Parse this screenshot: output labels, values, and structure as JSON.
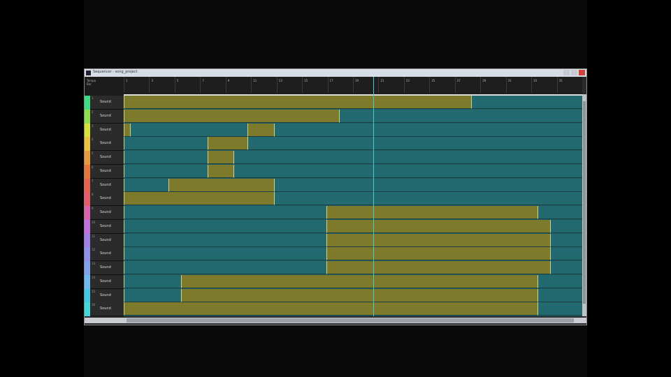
{
  "window": {
    "title": "Sequencer - song_project",
    "controls": [
      "minimize",
      "maximize",
      "close"
    ]
  },
  "corner": {
    "line1": "Tempo",
    "line2": "Bar"
  },
  "ruler": {
    "bars": [
      1,
      3,
      5,
      7,
      9,
      11,
      13,
      15,
      17,
      19,
      21,
      23,
      25,
      27,
      29,
      31,
      33,
      35
    ],
    "total_bars": 36
  },
  "playhead_bar": 19.6,
  "colors": {
    "olive": "#7d7a2c",
    "teal": "#236a70",
    "playhead": "#3fd3c6"
  },
  "tracks": [
    {
      "num": "1",
      "name": "Sound",
      "color": "#3ddc84",
      "clips": [
        {
          "s": 0,
          "e": 27.3,
          "t": "olive"
        },
        {
          "s": 27.3,
          "e": 36,
          "t": "teal"
        }
      ]
    },
    {
      "num": "2",
      "name": "Sound",
      "color": "#8ee04a",
      "clips": [
        {
          "s": 0,
          "e": 16.9,
          "t": "olive"
        },
        {
          "s": 16.9,
          "e": 36,
          "t": "teal"
        }
      ]
    },
    {
      "num": "3",
      "name": "Sound",
      "color": "#d8e03a",
      "clips": [
        {
          "s": 0,
          "e": 0.5,
          "t": "olive"
        },
        {
          "s": 0.5,
          "e": 9.7,
          "t": "teal"
        },
        {
          "s": 9.7,
          "e": 11.8,
          "t": "olive"
        },
        {
          "s": 11.8,
          "e": 36,
          "t": "teal"
        }
      ]
    },
    {
      "num": "4",
      "name": "Sound",
      "color": "#e8c23a",
      "clips": [
        {
          "s": 0,
          "e": 6.6,
          "t": "teal"
        },
        {
          "s": 6.6,
          "e": 9.7,
          "t": "olive"
        },
        {
          "s": 9.7,
          "e": 36,
          "t": "teal"
        }
      ]
    },
    {
      "num": "5",
      "name": "Sound",
      "color": "#e89a3a",
      "clips": [
        {
          "s": 0,
          "e": 6.6,
          "t": "teal"
        },
        {
          "s": 6.6,
          "e": 8.6,
          "t": "olive"
        },
        {
          "s": 8.6,
          "e": 36,
          "t": "teal"
        }
      ]
    },
    {
      "num": "6",
      "name": "Sound",
      "color": "#e8763a",
      "clips": [
        {
          "s": 0,
          "e": 6.6,
          "t": "teal"
        },
        {
          "s": 6.6,
          "e": 8.6,
          "t": "olive"
        },
        {
          "s": 8.6,
          "e": 36,
          "t": "teal"
        }
      ]
    },
    {
      "num": "7",
      "name": "Sound",
      "color": "#e8604a",
      "clips": [
        {
          "s": 0,
          "e": 3.5,
          "t": "teal"
        },
        {
          "s": 3.5,
          "e": 11.8,
          "t": "olive"
        },
        {
          "s": 11.8,
          "e": 36,
          "t": "teal"
        }
      ]
    },
    {
      "num": "8",
      "name": "Sound",
      "color": "#e85a6a",
      "clips": [
        {
          "s": 0,
          "e": 11.8,
          "t": "olive"
        },
        {
          "s": 11.8,
          "e": 36,
          "t": "teal"
        }
      ]
    },
    {
      "num": "9",
      "name": "Sound",
      "color": "#e060b0",
      "clips": [
        {
          "s": 0,
          "e": 15.9,
          "t": "teal"
        },
        {
          "s": 15.9,
          "e": 32.5,
          "t": "olive"
        },
        {
          "s": 32.5,
          "e": 36,
          "t": "teal"
        }
      ]
    },
    {
      "num": "10",
      "name": "Sound",
      "color": "#c070e0",
      "clips": [
        {
          "s": 0,
          "e": 15.9,
          "t": "teal"
        },
        {
          "s": 15.9,
          "e": 33.5,
          "t": "olive"
        },
        {
          "s": 33.5,
          "e": 36,
          "t": "teal"
        }
      ]
    },
    {
      "num": "11",
      "name": "Sound",
      "color": "#a080e8",
      "clips": [
        {
          "s": 0,
          "e": 15.9,
          "t": "teal"
        },
        {
          "s": 15.9,
          "e": 33.5,
          "t": "olive"
        },
        {
          "s": 33.5,
          "e": 36,
          "t": "teal"
        }
      ]
    },
    {
      "num": "12",
      "name": "Sound",
      "color": "#9090ec",
      "clips": [
        {
          "s": 0,
          "e": 15.9,
          "t": "teal"
        },
        {
          "s": 15.9,
          "e": 33.5,
          "t": "olive"
        },
        {
          "s": 33.5,
          "e": 36,
          "t": "teal"
        }
      ]
    },
    {
      "num": "13",
      "name": "Sound",
      "color": "#80a0f0",
      "clips": [
        {
          "s": 0,
          "e": 15.9,
          "t": "teal"
        },
        {
          "s": 15.9,
          "e": 33.5,
          "t": "olive"
        },
        {
          "s": 33.5,
          "e": 36,
          "t": "teal"
        }
      ]
    },
    {
      "num": "14",
      "name": "Sound",
      "color": "#70b8f0",
      "clips": [
        {
          "s": 0,
          "e": 4.5,
          "t": "teal"
        },
        {
          "s": 4.5,
          "e": 32.5,
          "t": "olive"
        },
        {
          "s": 32.5,
          "e": 36,
          "t": "teal"
        }
      ]
    },
    {
      "num": "15",
      "name": "Sound",
      "color": "#40c8e8",
      "clips": [
        {
          "s": 0,
          "e": 4.5,
          "t": "teal"
        },
        {
          "s": 4.5,
          "e": 32.5,
          "t": "olive"
        },
        {
          "s": 32.5,
          "e": 36,
          "t": "teal"
        }
      ]
    },
    {
      "num": "16",
      "name": "Sound",
      "color": "#40d8d8",
      "clips": [
        {
          "s": 0,
          "e": 32.5,
          "t": "olive"
        },
        {
          "s": 32.5,
          "e": 36,
          "t": "teal"
        }
      ]
    }
  ]
}
